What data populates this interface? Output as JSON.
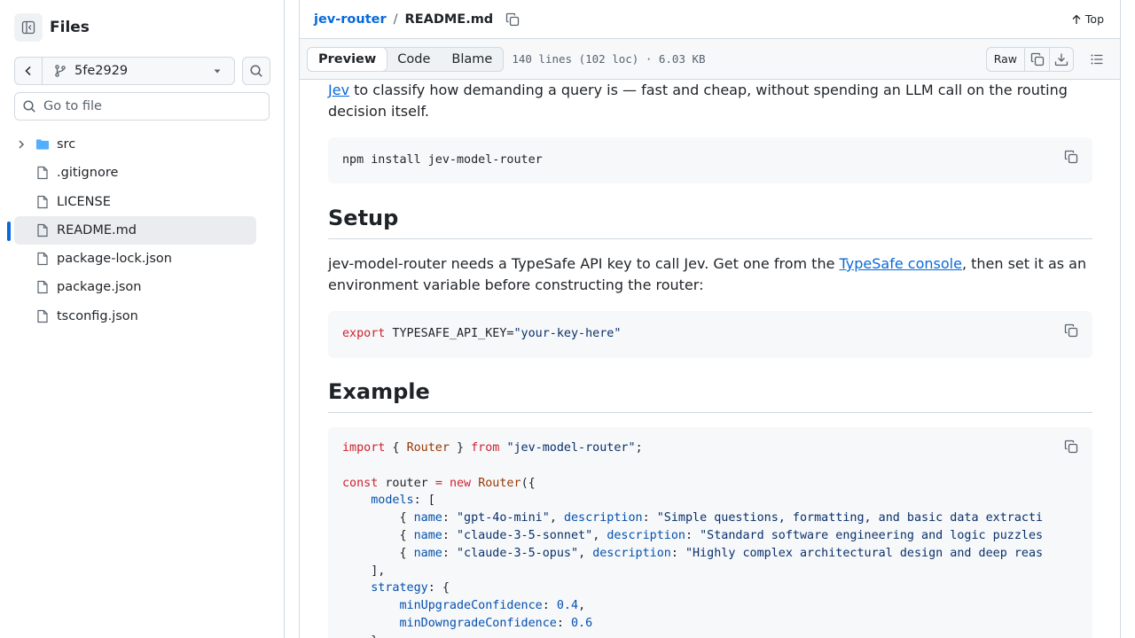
{
  "sidebar": {
    "title": "Files",
    "branch": "5fe2929",
    "goto_placeholder": "Go to file",
    "items": [
      {
        "type": "folder",
        "label": "src"
      },
      {
        "type": "file",
        "label": ".gitignore"
      },
      {
        "type": "file",
        "label": "LICENSE"
      },
      {
        "type": "file",
        "label": "README.md",
        "selected": true
      },
      {
        "type": "file",
        "label": "package-lock.json"
      },
      {
        "type": "file",
        "label": "package.json"
      },
      {
        "type": "file",
        "label": "tsconfig.json"
      }
    ]
  },
  "header": {
    "repo": "jev-router",
    "separator": "/",
    "file": "README.md",
    "top_label": "Top"
  },
  "toolbar": {
    "tabs": [
      "Preview",
      "Code",
      "Blame"
    ],
    "active_tab": "Preview",
    "meta": "140 lines (102 loc) · 6.03 KB",
    "raw_label": "Raw"
  },
  "content": {
    "intro_link": "Jev",
    "intro_rest": " to classify how demanding a query is — fast and cheap, without spending an LLM call on the routing decision itself.",
    "install_cmd": "npm install jev-model-router",
    "setup_heading": "Setup",
    "setup_text_1": "jev-model-router needs a TypeSafe API key to call Jev. Get one from the ",
    "setup_link": "TypeSafe console",
    "setup_text_2": ", then set it as an environment variable before constructing the router:",
    "export_kw": "export",
    "export_var": " TYPESAFE_API_KEY=",
    "export_val": "\"your-key-here\"",
    "example_heading": "Example",
    "example_code": [
      [
        [
          "kw",
          "import"
        ],
        [
          "",
          " { "
        ],
        [
          "cls",
          "Router"
        ],
        [
          "",
          " } "
        ],
        [
          "kw",
          "from"
        ],
        [
          "",
          " "
        ],
        [
          "str",
          "\"jev-model-router\""
        ],
        [
          "",
          ";"
        ]
      ],
      [],
      [
        [
          "kw",
          "const"
        ],
        [
          "",
          " router "
        ],
        [
          "kw",
          "="
        ],
        [
          "",
          " "
        ],
        [
          "kw",
          "new"
        ],
        [
          "",
          " "
        ],
        [
          "cls",
          "Router"
        ],
        [
          "",
          "({"
        ]
      ],
      [
        [
          "",
          "    "
        ],
        [
          "prop",
          "models"
        ],
        [
          "",
          ": ["
        ]
      ],
      [
        [
          "",
          "        { "
        ],
        [
          "prop",
          "name"
        ],
        [
          "",
          ": "
        ],
        [
          "str",
          "\"gpt-4o-mini\""
        ],
        [
          "",
          ", "
        ],
        [
          "prop",
          "description"
        ],
        [
          "",
          ": "
        ],
        [
          "str",
          "\"Simple questions, formatting, and basic data extracti"
        ]
      ],
      [
        [
          "",
          "        { "
        ],
        [
          "prop",
          "name"
        ],
        [
          "",
          ": "
        ],
        [
          "str",
          "\"claude-3-5-sonnet\""
        ],
        [
          "",
          ", "
        ],
        [
          "prop",
          "description"
        ],
        [
          "",
          ": "
        ],
        [
          "str",
          "\"Standard software engineering and logic puzzles"
        ]
      ],
      [
        [
          "",
          "        { "
        ],
        [
          "prop",
          "name"
        ],
        [
          "",
          ": "
        ],
        [
          "str",
          "\"claude-3-5-opus\""
        ],
        [
          "",
          ", "
        ],
        [
          "prop",
          "description"
        ],
        [
          "",
          ": "
        ],
        [
          "str",
          "\"Highly complex architectural design and deep reas"
        ]
      ],
      [
        [
          "",
          "    ],"
        ]
      ],
      [
        [
          "",
          "    "
        ],
        [
          "prop",
          "strategy"
        ],
        [
          "",
          ": {"
        ]
      ],
      [
        [
          "",
          "        "
        ],
        [
          "prop",
          "minUpgradeConfidence"
        ],
        [
          "",
          ": "
        ],
        [
          "num",
          "0.4"
        ],
        [
          "",
          ","
        ]
      ],
      [
        [
          "",
          "        "
        ],
        [
          "prop",
          "minDowngradeConfidence"
        ],
        [
          "",
          ": "
        ],
        [
          "num",
          "0.6"
        ]
      ],
      [
        [
          "",
          "    }"
        ]
      ]
    ]
  },
  "colors": {
    "link": "#0969da",
    "selected_bar": "#0969da",
    "folder": "#54aeff",
    "keyword": "#cf222e",
    "string": "#0a3069",
    "class": "#953800",
    "property": "#0550ae"
  }
}
